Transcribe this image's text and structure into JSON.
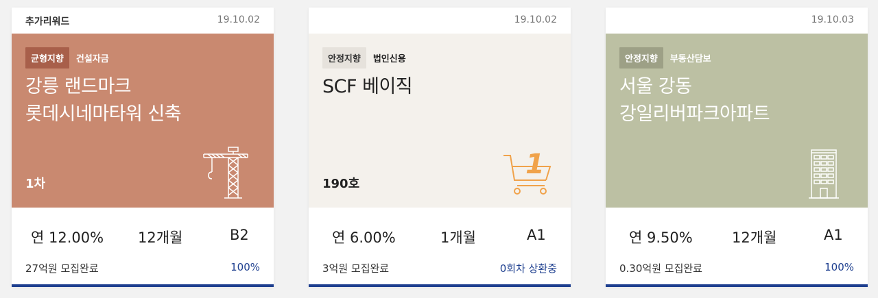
{
  "cards": [
    {
      "top_label": "추가리워드",
      "date": "19.10.02",
      "badge": "균형지향",
      "category": "건설자금",
      "title_lines": [
        "강릉 랜드마크",
        "롯데시네마타워 신축"
      ],
      "round": "1차",
      "illustration": "crane-icon",
      "rate": "연 12.00%",
      "period": "12개월",
      "grade": "B2",
      "amount": "27억원 모집완료",
      "status": "100%"
    },
    {
      "top_label": "",
      "date": "19.10.02",
      "badge": "안정지향",
      "category": "법인신용",
      "title_lines": [
        "SCF 베이직"
      ],
      "round": "190호",
      "illustration": "shopping-cart-icon",
      "cart_number": "1",
      "rate": "연 6.00%",
      "period": "1개월",
      "grade": "A1",
      "amount": "3억원 모집완료",
      "status": "0회차 상환중"
    },
    {
      "top_label": "",
      "date": "19.10.03",
      "badge": "안정지향",
      "category": "부동산담보",
      "title_lines": [
        "서울 강동",
        "강일리버파크아파트"
      ],
      "round": "",
      "illustration": "apartment-building-icon",
      "rate": "연 9.50%",
      "period": "12개월",
      "grade": "A1",
      "amount": "0.30억원 모집완료",
      "status": "100%"
    }
  ],
  "colors": {
    "card1_hero": "#c98970",
    "card2_hero": "#f4f1ec",
    "card3_hero": "#bcc0a3",
    "accent_blue": "#1e3f8f",
    "cart_orange": "#f0a24a"
  }
}
